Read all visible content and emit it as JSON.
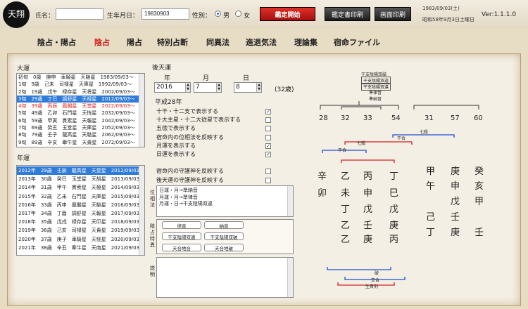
{
  "header": {
    "logo_text": "天翔",
    "name_label": "氏名：",
    "name_value": "",
    "birth_label": "生年月日：",
    "birth_value": "19830903",
    "gender_label": "性別：",
    "gender_male": "男",
    "gender_female": "女",
    "start_button": "鑑定開始",
    "print_button": "鑑定書印刷",
    "screen_print_button": "画面印刷",
    "date_line1": "1983/09/03(土)",
    "date_line2": "昭和58年9月3日土曜日",
    "version": "Ver:1.1.1.0"
  },
  "menu": [
    "陰占・陽占",
    "陰占",
    "陽占",
    "特別占断",
    "同異法",
    "進退気法",
    "理論集",
    "宿命ファイル"
  ],
  "taiun": {
    "title": "大運",
    "rows": [
      "初旬　0歳　庚申　車騎星　天馳星　1983/09/03〜",
      "1旬　9歳　己未　司禄星　天庫星　1992/09/03〜",
      "2旬　19歳　戊午　禄存星　天将星　2002/09/03〜",
      "3旬　29歳　丁巳　調舒星　天禄星　2012/09/03〜",
      "4旬　39歳　丙辰　鳳閣星　天堂星　2022/09/03〜",
      "5旬　49歳　乙卯　石門星　天恍星　2032/09/03〜",
      "6旬　59歳　甲寅　貫索星　天報星　2042/09/03〜",
      "7旬　69歳　癸丑　玉堂星　天庫星　2052/09/03〜",
      "8旬　79歳　壬子　龍高星　天馳星　2062/09/03〜",
      "9旬　89歳　辛亥　牽牛星　天貴星　2072/09/03〜"
    ],
    "selected": 3,
    "highlight": 4
  },
  "nenun": {
    "title": "年運",
    "rows": [
      "2012年　29歳　壬辰　龍高星　天堂星　2012/09/03〜",
      "2013年　30歳　癸巳　玉堂星　天胡星　2013/09/03〜",
      "2014年　31歳　甲午　貫索星　天極星　2014/09/03〜",
      "2015年　32歳　乙未　石門星　天庫星　2015/09/03〜",
      "2016年　33歳　丙申　鳳閣星　天馳星　2016/09/03〜",
      "2017年　34歳　丁酉　調舒星　天報星　2017/09/03〜",
      "2018年　35歳　戊戌　禄存星　天印星　2018/09/03〜",
      "2019年　36歳　己亥　司禄星　天貴星　2019/09/03〜",
      "2020年　37歳　庚子　車騎星　天恍星　2020/09/03〜",
      "2021年　38歳　辛丑　牽牛星　天南星　2021/09/03〜"
    ],
    "selected": 0
  },
  "kouten": {
    "title": "後天運",
    "year_label": "年",
    "month_label": "月",
    "day_label": "日",
    "year": "2016",
    "month": "7",
    "day": "8",
    "age": "(32歳)",
    "era": "平成28年",
    "options": [
      "十干・十二支で表示する",
      "十大主星・十二大従星で表示する",
      "五徳で表示する",
      "宿命内の位相法を反映する",
      "月運を表示する",
      "日運を表示する",
      "宿命内の守護神を反映する",
      "後天運の守護神を反映する"
    ],
    "checks": [
      true,
      false,
      false,
      false,
      true,
      true,
      false,
      false
    ],
    "isouhou_label": "位相法",
    "isouhou_lines": [
      "日運・月→準納音",
      "月運・月→準律音",
      "月運・日→干支陰陽双違"
    ],
    "inyou_label": "陰占特異",
    "special_buttons": [
      "律音",
      "納音",
      "干支陰陽双違",
      "干支陰陽双破",
      "天合地合",
      "天合地破"
    ],
    "explain_label": "説明"
  },
  "diagram": {
    "top_labels": [
      "干支陰陽双破",
      "干支陰陽双違",
      "干支陰陽双違",
      "準律音",
      "準納音"
    ],
    "numbers": [
      "28",
      "32",
      "33",
      "54",
      "31",
      "57",
      "60"
    ],
    "rel_labels": [
      "七殺",
      "干合",
      "七殺",
      "干合"
    ],
    "cols": [
      [
        "辛",
        "卯",
        "",
        "",
        ""
      ],
      [
        "乙",
        "未",
        "丁",
        "乙",
        "乙"
      ],
      [
        "丙",
        "申",
        "戊",
        "壬",
        "庚"
      ],
      [
        "丁",
        "巳",
        "戊",
        "庚",
        "丙"
      ],
      [
        "甲",
        "午",
        "",
        "己",
        "丁"
      ],
      [
        "庚",
        "申",
        "戊",
        "壬",
        "庚"
      ],
      [
        "癸",
        "亥",
        "甲",
        "",
        "壬"
      ]
    ],
    "bottom_labels": [
      "破",
      "支合",
      "生貴刑"
    ]
  }
}
